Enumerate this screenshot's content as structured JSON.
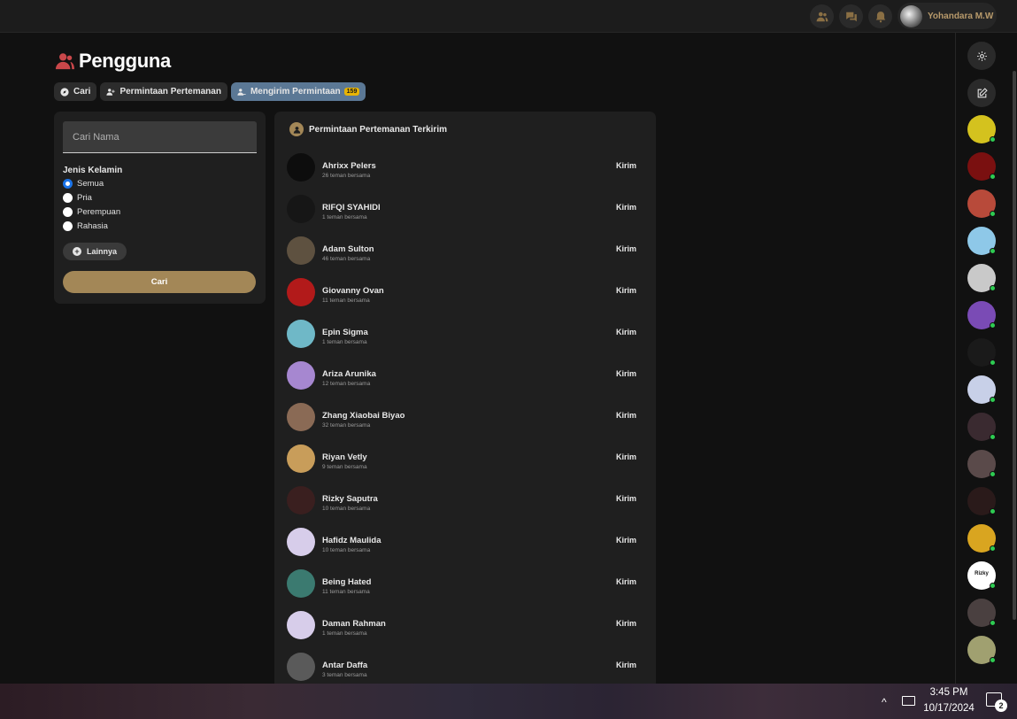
{
  "topbar": {
    "icons": [
      "users-icon",
      "chat-icon",
      "bell-icon"
    ],
    "user_name": "Yohandara M.W"
  },
  "page": {
    "title": "Pengguna",
    "icon": "users-icon"
  },
  "tabs": [
    {
      "label": "Cari",
      "icon": "compass-icon",
      "active": false
    },
    {
      "label": "Permintaan Pertemanan",
      "icon": "user-plus-icon",
      "active": false
    },
    {
      "label": "Mengirim Permintaan",
      "icon": "user-send-icon",
      "active": true,
      "badge": "159"
    }
  ],
  "filter": {
    "search_placeholder": "Cari Nama",
    "gender_label": "Jenis Kelamin",
    "options": [
      {
        "label": "Semua",
        "selected": true
      },
      {
        "label": "Pria",
        "selected": false
      },
      {
        "label": "Perempuan",
        "selected": false
      },
      {
        "label": "Rahasia",
        "selected": false
      }
    ],
    "more_label": "Lainnya",
    "search_button": "Cari"
  },
  "list": {
    "title": "Permintaan Pertemanan Terkirim",
    "rows": [
      {
        "name": "Ahrixx Pelers",
        "mutual": "26 teman bersama",
        "action": "Kirim",
        "avatar_color": "#0d0d0d"
      },
      {
        "name": "RIFQI SYAHIDI",
        "mutual": "1 teman bersama",
        "action": "Kirim",
        "avatar_color": "#161616"
      },
      {
        "name": "Adam Sulton",
        "mutual": "46 teman bersama",
        "action": "Kirim",
        "avatar_color": "#5e5140"
      },
      {
        "name": "Giovanny Ovan",
        "mutual": "11 teman bersama",
        "action": "Kirim",
        "avatar_color": "#b21a1a"
      },
      {
        "name": "Epin Sigma",
        "mutual": "1 teman bersama",
        "action": "Kirim",
        "avatar_color": "#6fb8c7"
      },
      {
        "name": "Ariza Arunika",
        "mutual": "12 teman bersama",
        "action": "Kirim",
        "avatar_color": "#a687d0"
      },
      {
        "name": "Zhang Xiaobai Biyao",
        "mutual": "32 teman bersama",
        "action": "Kirim",
        "avatar_color": "#8a6a55"
      },
      {
        "name": "Riyan Vetly",
        "mutual": "9 teman bersama",
        "action": "Kirim",
        "avatar_color": "#c89d5a"
      },
      {
        "name": "Rizky Saputra",
        "mutual": "10 teman bersama",
        "action": "Kirim",
        "avatar_color": "#3a1f1f"
      },
      {
        "name": "Hafidz Maulida",
        "mutual": "10 teman bersama",
        "action": "Kirim",
        "avatar_color": "#d7cdea"
      },
      {
        "name": "Being Hated",
        "mutual": "11 teman bersama",
        "action": "Kirim",
        "avatar_color": "#3b7a70"
      },
      {
        "name": "Daman Rahman",
        "mutual": "1 teman bersama",
        "action": "Kirim",
        "avatar_color": "#d7cdea"
      },
      {
        "name": "Antar Daffa",
        "mutual": "3 teman bersama",
        "action": "Kirim",
        "avatar_color": "#5a5a5a"
      }
    ]
  },
  "rail": {
    "buttons": [
      "gear-icon",
      "edit-icon"
    ],
    "avatar_colors": [
      "#d4c21e",
      "#7a1010",
      "#b84a3a",
      "#8ec8e8",
      "#c9c9c9",
      "#7a4bb5",
      "#1a1a1a",
      "#c8d0e8",
      "#3a2a30",
      "#5a4a4a",
      "#2a1a1a",
      "#d9a520",
      "#ffffff",
      "#4a4040",
      "#a0a070"
    ],
    "avatar_label_white": "Rizky"
  },
  "taskbar": {
    "time": "3:45 PM",
    "date": "10/17/2024",
    "notifications": "2"
  }
}
